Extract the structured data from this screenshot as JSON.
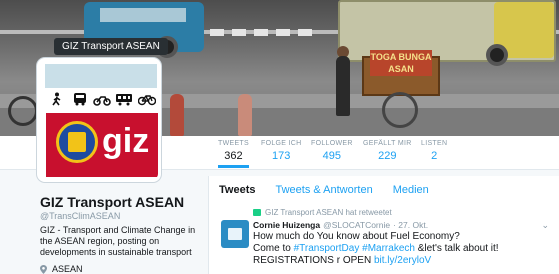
{
  "header": {
    "tooltip": "GIZ Transport ASEAN",
    "cart_sign": "TOGA  BUNGA ASAN"
  },
  "avatar": {
    "logo_text": "giz",
    "icons": [
      "walking-icon",
      "bus-icon",
      "motorbike-icon",
      "train-icon",
      "bicycle-icon"
    ]
  },
  "stats": [
    {
      "label": "TWEETS",
      "value": "362"
    },
    {
      "label": "FOLGE ICH",
      "value": "173"
    },
    {
      "label": "FOLLOWER",
      "value": "495"
    },
    {
      "label": "GEFÄLLT MIR",
      "value": "229"
    },
    {
      "label": "LISTEN",
      "value": "2"
    }
  ],
  "profile": {
    "name": "GIZ Transport ASEAN",
    "handle": "@TransClimASEAN",
    "bio": "GIZ - Transport and Climate Change in the ASEAN region, posting on developments in sustainable transport",
    "location": "ASEAN"
  },
  "timeline": {
    "tabs": [
      "Tweets",
      "Tweets & Antworten",
      "Medien"
    ],
    "retweet_note": "GIZ Transport ASEAN hat retweetet",
    "tweet": {
      "author": "Cornie Huizenga",
      "handle": "@SLOCATCornie",
      "time": "· 27. Okt.",
      "line1": "How much do You know about Fuel Economy?",
      "line2_pre": "Come to ",
      "hashtag1": "#TransportDay",
      "hashtag2": "#Marrakech",
      "line2_post": " &let's talk about it!",
      "line3_pre": "REGISTRATIONS r OPEN ",
      "link": "bit.ly/2eryloV"
    }
  },
  "colors": {
    "accent": "#1da1f2",
    "giz_red": "#c8102e"
  }
}
